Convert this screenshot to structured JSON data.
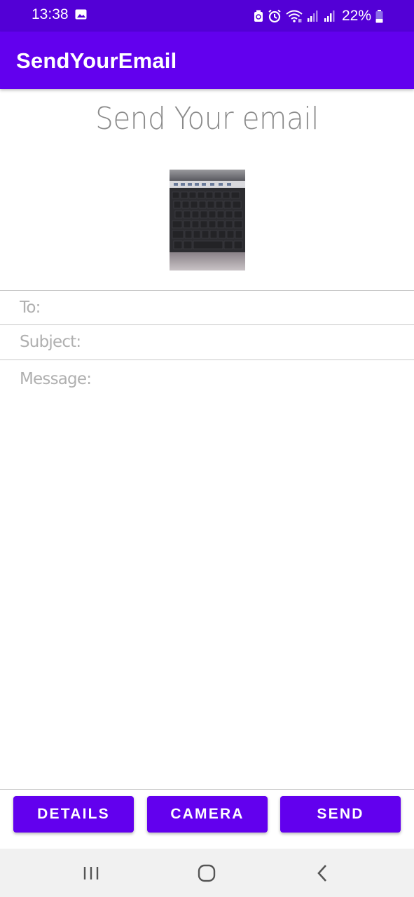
{
  "status_bar": {
    "time": "13:38",
    "battery": "22%",
    "icons": [
      "image-icon",
      "battery-saver-icon",
      "alarm-icon",
      "wifi-icon",
      "signal-icon",
      "signal-icon",
      "battery-icon"
    ]
  },
  "app_bar": {
    "title": "SendYourEmail",
    "color": "#6200ee"
  },
  "main": {
    "heading": "Send Your email",
    "photo_icon": "keyboard-photo"
  },
  "form": {
    "to_placeholder": "To:",
    "subject_placeholder": "Subject:",
    "message_placeholder": "Message:"
  },
  "buttons": {
    "details_label": "DETAILS",
    "camera_label": "CAMERA",
    "send_label": "SEND",
    "color": "#6200ee"
  },
  "nav_bar": {
    "icons": [
      "recent-apps-icon",
      "home-icon",
      "back-icon"
    ]
  }
}
